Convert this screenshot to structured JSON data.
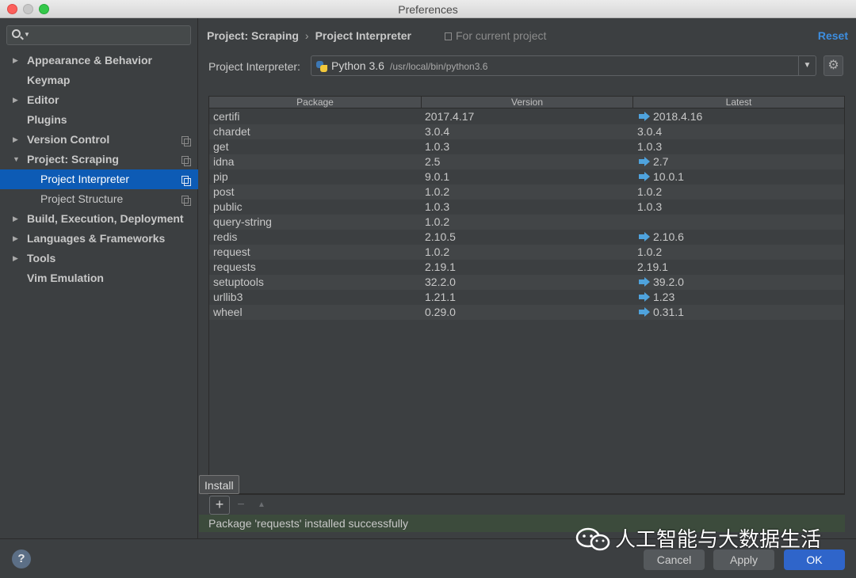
{
  "window": {
    "title": "Preferences"
  },
  "sidebar": {
    "search_placeholder": "",
    "items": [
      {
        "label": "Appearance & Behavior",
        "arrow": "▶"
      },
      {
        "label": "Keymap",
        "arrow": ""
      },
      {
        "label": "Editor",
        "arrow": "▶"
      },
      {
        "label": "Plugins",
        "arrow": ""
      },
      {
        "label": "Version Control",
        "arrow": "▶"
      },
      {
        "label": "Project: Scraping",
        "arrow": "▼"
      },
      {
        "label": "Project Interpreter",
        "arrow": ""
      },
      {
        "label": "Project Structure",
        "arrow": ""
      },
      {
        "label": "Build, Execution, Deployment",
        "arrow": "▶"
      },
      {
        "label": "Languages & Frameworks",
        "arrow": "▶"
      },
      {
        "label": "Tools",
        "arrow": "▶"
      },
      {
        "label": "Vim Emulation",
        "arrow": ""
      }
    ]
  },
  "header": {
    "breadcrumb_root": "Project: Scraping",
    "breadcrumb_sep": "›",
    "breadcrumb_current": "Project Interpreter",
    "for_current": "For current project",
    "reset_label": "Reset"
  },
  "interpreter": {
    "label": "Project Interpreter:",
    "name": "Python 3.6",
    "path": "/usr/local/bin/python3.6",
    "dropdown_icon": "chevron-down-icon",
    "settings_icon": "gear-icon"
  },
  "table": {
    "columns": [
      "Package",
      "Version",
      "Latest"
    ],
    "rows": [
      {
        "package": "certifi",
        "version": "2017.4.17",
        "latest": "2018.4.16",
        "upgrade": true
      },
      {
        "package": "chardet",
        "version": "3.0.4",
        "latest": "3.0.4",
        "upgrade": false
      },
      {
        "package": "get",
        "version": "1.0.3",
        "latest": "1.0.3",
        "upgrade": false
      },
      {
        "package": "idna",
        "version": "2.5",
        "latest": "2.7",
        "upgrade": true
      },
      {
        "package": "pip",
        "version": "9.0.1",
        "latest": "10.0.1",
        "upgrade": true
      },
      {
        "package": "post",
        "version": "1.0.2",
        "latest": "1.0.2",
        "upgrade": false
      },
      {
        "package": "public",
        "version": "1.0.3",
        "latest": "1.0.3",
        "upgrade": false
      },
      {
        "package": "query-string",
        "version": "1.0.2",
        "latest": "",
        "upgrade": false
      },
      {
        "package": "redis",
        "version": "2.10.5",
        "latest": "2.10.6",
        "upgrade": true
      },
      {
        "package": "request",
        "version": "1.0.2",
        "latest": "1.0.2",
        "upgrade": false
      },
      {
        "package": "requests",
        "version": "2.19.1",
        "latest": "2.19.1",
        "upgrade": false
      },
      {
        "package": "setuptools",
        "version": "32.2.0",
        "latest": "39.2.0",
        "upgrade": true
      },
      {
        "package": "urllib3",
        "version": "1.21.1",
        "latest": "1.23",
        "upgrade": true
      },
      {
        "package": "wheel",
        "version": "0.29.0",
        "latest": "0.31.1",
        "upgrade": true
      }
    ]
  },
  "toolbar": {
    "add_label": "+",
    "remove_label": "−",
    "up_label": "▲",
    "tooltip": "Install"
  },
  "status": {
    "message": "Package 'requests' installed successfully"
  },
  "footer": {
    "help_label": "?",
    "cancel_label": "Cancel",
    "apply_label": "Apply",
    "ok_label": "OK"
  },
  "watermark": {
    "text": "人工智能与大数据生活"
  }
}
